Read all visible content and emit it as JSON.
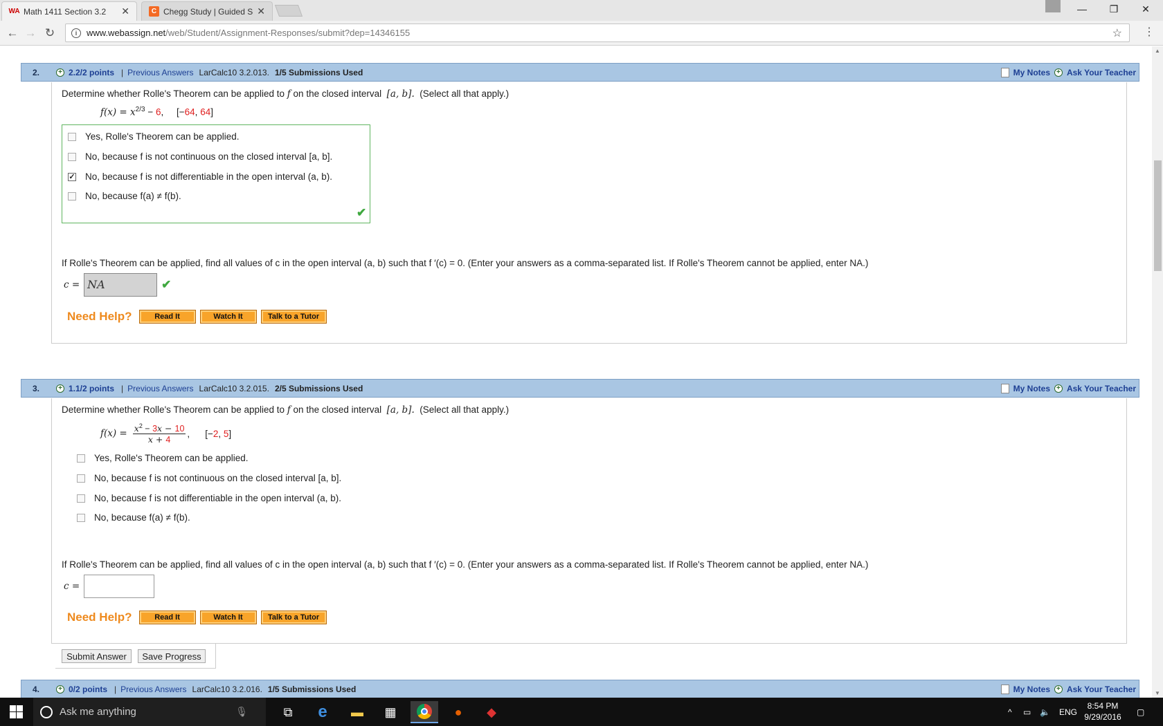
{
  "browser": {
    "tabs": [
      {
        "icon": "webassign-icon",
        "title": "Math 1411 Section 3.2",
        "favicon": "WA"
      },
      {
        "icon": "chegg-icon",
        "title": "Chegg Study | Guided So",
        "favicon": "C"
      }
    ],
    "url_host": "www.webassign.net",
    "url_path": "/web/Student/Assignment-Responses/submit?dep=14346155"
  },
  "questions": [
    {
      "number": "2.",
      "points": "2.2/2 points",
      "sep": "|",
      "previous": "Previous Answers",
      "ref": "LarCalc10 3.2.013.",
      "submissions": "1/5 Submissions Used",
      "my_notes": "My Notes",
      "ask": "Ask Your Teacher",
      "prompt_a": "Determine whether Rolle's Theorem can be applied to",
      "prompt_f": "f",
      "prompt_b": "on the closed interval",
      "prompt_interval": "[a, b].",
      "prompt_c": "(Select all that apply.)",
      "formula_lhs": "f(x) = x",
      "formula_exp": "2/3",
      "formula_mid": " − ",
      "formula_const": "6",
      "formula_comma": ",",
      "interval_open": "[−",
      "interval_a": "64",
      "interval_sep": ", ",
      "interval_b": "64",
      "interval_close": "]",
      "choices": [
        {
          "checked": false,
          "text": "Yes, Rolle's Theorem can be applied."
        },
        {
          "checked": false,
          "text": "No, because f is not continuous on the closed interval [a, b]."
        },
        {
          "checked": true,
          "text": "No, because f is not differentiable in the open interval (a, b)."
        },
        {
          "checked": false,
          "text": "No, because f(a) ≠ f(b)."
        }
      ],
      "find_text": "If Rolle's Theorem can be applied, find all values of c in the open interval  (a, b)  such that  f ′(c) = 0.  (Enter your answers as a comma-separated list. If Rolle's Theorem cannot be applied, enter NA.)",
      "c_label": "c =",
      "c_value": "NA",
      "need_help": "Need Help?",
      "help_buttons": [
        "Read It",
        "Watch It",
        "Talk to a Tutor"
      ]
    },
    {
      "number": "3.",
      "points": "1.1/2 points",
      "sep": "|",
      "previous": "Previous Answers",
      "ref": "LarCalc10 3.2.015.",
      "submissions": "2/5 Submissions Used",
      "my_notes": "My Notes",
      "ask": "Ask Your Teacher",
      "prompt_a": "Determine whether Rolle's Theorem can be applied to",
      "prompt_f": "f",
      "prompt_b": "on the closed interval",
      "prompt_interval": "[a, b].",
      "prompt_c": "(Select all that apply.)",
      "formula_lhs": "f(x) =",
      "num_a": "x",
      "num_exp": "2",
      "num_b": " − ",
      "num_c": "3",
      "num_d": "x − ",
      "num_e": "10",
      "den_a": "x + ",
      "den_b": "4",
      "formula_comma": ",",
      "interval_open": "[−",
      "interval_a": "2",
      "interval_sep": ", ",
      "interval_b": "5",
      "interval_close": "]",
      "choices": [
        {
          "checked": false,
          "text": "Yes, Rolle's Theorem can be applied."
        },
        {
          "checked": false,
          "text": "No, because f is not continuous on the closed interval [a, b]."
        },
        {
          "checked": false,
          "text": "No, because f is not differentiable in the open interval (a, b)."
        },
        {
          "checked": false,
          "text": "No, because f(a) ≠ f(b)."
        }
      ],
      "find_text": "If Rolle's Theorem can be applied, find all values of c in the open interval  (a, b)  such that  f ′(c) = 0.  (Enter your answers as a comma-separated list. If Rolle's Theorem cannot be applied, enter NA.)",
      "c_label": "c =",
      "c_value": "",
      "need_help": "Need Help?",
      "help_buttons": [
        "Read It",
        "Watch It",
        "Talk to a Tutor"
      ],
      "submit_answer": "Submit Answer",
      "save_progress": "Save Progress"
    },
    {
      "number": "4.",
      "points": "0/2 points",
      "sep": "|",
      "previous": "Previous Answers",
      "ref": "LarCalc10 3.2.016.",
      "submissions": "1/5 Submissions Used",
      "my_notes": "My Notes",
      "ask": "Ask Your Teacher"
    }
  ],
  "taskbar": {
    "search_placeholder": "Ask me anything",
    "language": "ENG",
    "time": "8:54 PM",
    "date": "9/29/2016"
  }
}
